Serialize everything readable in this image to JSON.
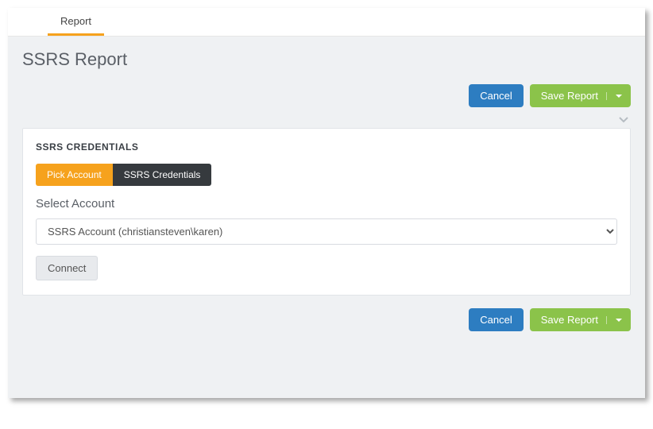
{
  "tabs": {
    "report": "Report"
  },
  "page": {
    "title": "SSRS Report"
  },
  "actions": {
    "cancel": "Cancel",
    "save_report": "Save Report"
  },
  "card": {
    "section_title": "SSRS CREDENTIALS",
    "subtabs": {
      "pick_account": "Pick Account",
      "ssrs_credentials": "SSRS Credentials"
    },
    "select_account": {
      "label": "Select Account",
      "selected": "SSRS Account (christiansteven\\karen)",
      "options": [
        "SSRS Account (christiansteven\\karen)"
      ]
    },
    "connect": "Connect"
  }
}
